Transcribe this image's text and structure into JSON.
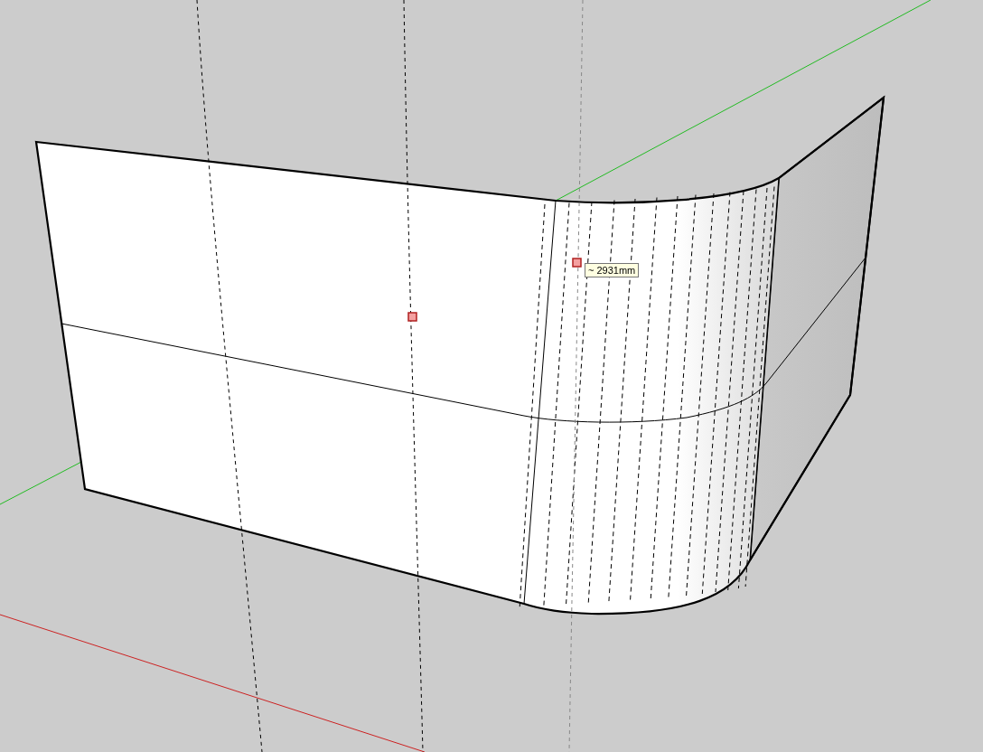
{
  "viewport": {
    "tooltip": "~ 2931mm"
  }
}
